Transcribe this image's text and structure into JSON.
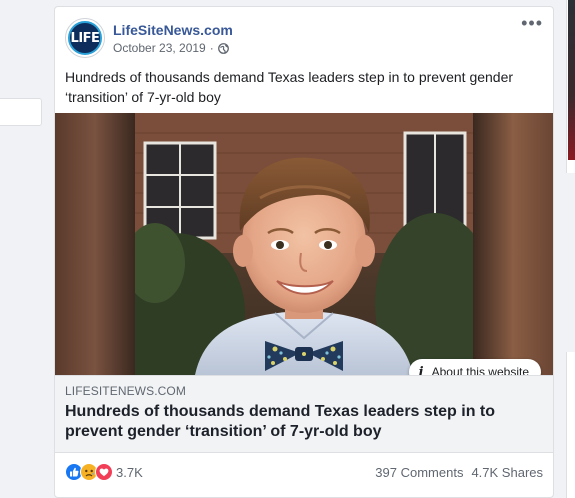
{
  "post": {
    "page_name": "LifeSiteNews.com",
    "avatar_text": "LIFE",
    "date": "October 23, 2019",
    "separator": "·",
    "privacy_icon": "globe-icon",
    "more_icon": "more-options-icon",
    "more_label": "•••",
    "text": "Hundreds of thousands demand Texas leaders step in to prevent gender ‘transition’ of 7-yr-old boy"
  },
  "link_preview": {
    "about_label": "About this website",
    "about_icon": "info-icon",
    "domain": "LIFESITENEWS.COM",
    "title": "Hundreds of thousands demand Texas leaders step in to prevent gender ‘transition’ of 7-yr-old boy"
  },
  "engagement": {
    "reaction_icons": [
      "like-icon",
      "sad-icon",
      "love-icon"
    ],
    "reaction_count": "3.7K",
    "comments": "397 Comments",
    "shares": "4.7K Shares"
  },
  "colors": {
    "page_name": "#385898",
    "like": "#1877f2",
    "sad": "#f7b125",
    "love": "#f33e58"
  }
}
